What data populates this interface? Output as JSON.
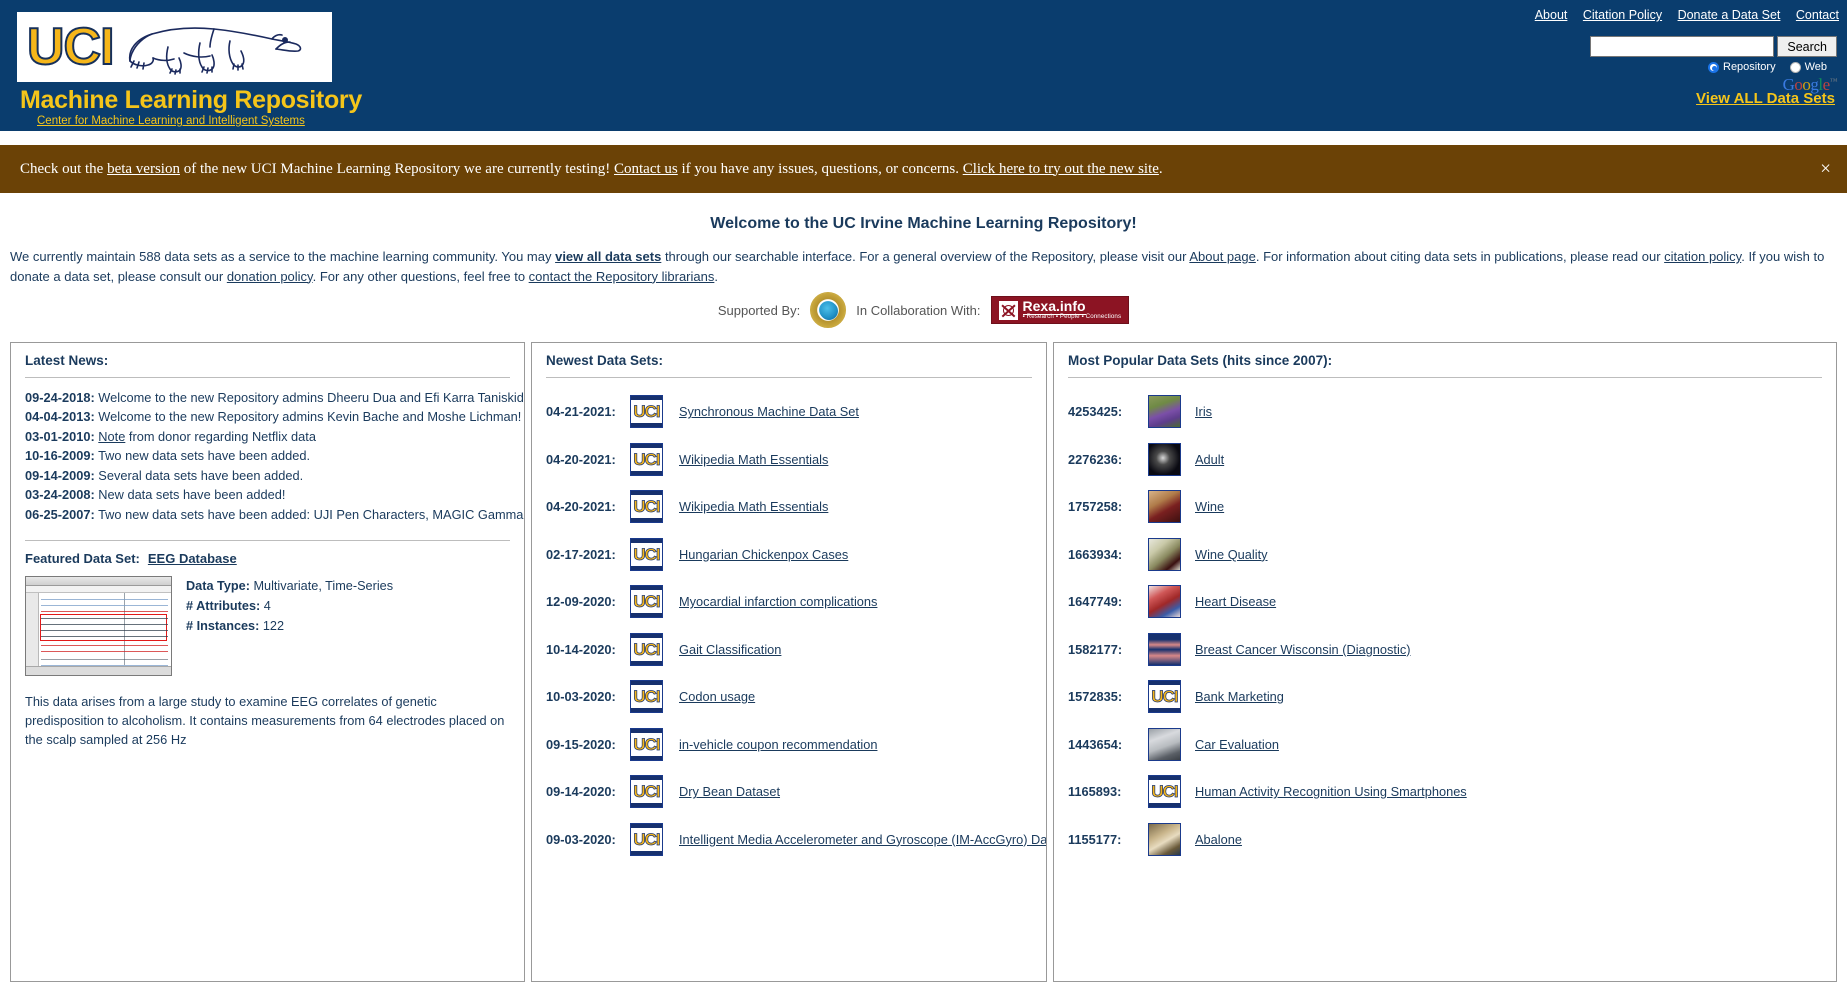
{
  "header": {
    "logo_text": "UCI",
    "repository_title": "Machine Learning Repository",
    "center_link": "Center for Machine Learning and Intelligent Systems",
    "nav": [
      {
        "label": "About"
      },
      {
        "label": "Citation Policy"
      },
      {
        "label": "Donate a Data Set"
      },
      {
        "label": "Contact"
      }
    ],
    "search": {
      "value": "",
      "placeholder": "",
      "button_label": "Search",
      "scope_repository": "Repository",
      "scope_web": "Web",
      "selected_scope": "Repository",
      "provider": "Google",
      "provider_tm": "™"
    },
    "view_all_label": "View ALL Data Sets",
    "colors": {
      "header_blue": "#0a3d6e",
      "gold": "#f5c51a"
    }
  },
  "banner": {
    "text_1": "Check out the ",
    "link_1": "beta version",
    "text_2": " of the new UCI Machine Learning Repository we are currently testing! ",
    "link_2": "Contact us",
    "text_3": " if you have any issues, questions, or concerns. ",
    "link_3": "Click here to try out the new site",
    "text_4": ".",
    "close_icon": "×",
    "color": "#6b4206"
  },
  "welcome": {
    "heading": "Welcome to the UC Irvine Machine Learning Repository!",
    "intro_1": "We currently maintain ",
    "intro_count": "588 data sets",
    "intro_2": " as a service to the machine learning community. You may ",
    "link_view_all": "view all data sets",
    "intro_3": " through our searchable interface. For a general overview of the Repository, please visit our ",
    "link_about": "About page",
    "intro_4": ". For information about citing data sets in publications, please read our ",
    "link_citation": "citation policy",
    "intro_5": ". If you wish to donate a data set, please consult our ",
    "link_donation": "donation policy",
    "intro_6": ". For any other questions, feel free to ",
    "link_librarians": "contact the Repository librarians",
    "intro_7": "."
  },
  "supporters": {
    "supported_by_label": "Supported By:",
    "nsf_name": "National Science Foundation",
    "collaboration_label": "In Collaboration With:",
    "rexa_name": "Rexa.info",
    "rexa_tagline": "▪ Research ▪ People ▪ Connections"
  },
  "news": {
    "heading": "Latest News:",
    "items": [
      {
        "date": "09-24-2018:",
        "text": "Welcome to the new Repository admins Dheeru Dua and Efi Karra Taniskidou!"
      },
      {
        "date": "04-04-2013:",
        "text": "Welcome to the new Repository admins Kevin Bache and Moshe Lichman!"
      },
      {
        "date": "03-01-2010:",
        "link": "Note",
        "text": " from donor regarding Netflix data"
      },
      {
        "date": "10-16-2009:",
        "text": "Two new data sets have been added."
      },
      {
        "date": "09-14-2009:",
        "text": "Several data sets have been added."
      },
      {
        "date": "03-24-2008:",
        "text": "New data sets have been added!"
      },
      {
        "date": "06-25-2007:",
        "text": "Two new data sets have been added: UJI Pen Characters, MAGIC Gamma Telescope"
      }
    ],
    "featured": {
      "label": "Featured Data Set:",
      "link": "EEG Database",
      "data_type_label": "Data Type:",
      "data_type_value": "Multivariate, Time-Series",
      "attributes_label": "# Attributes:",
      "attributes_value": "4",
      "instances_label": "# Instances:",
      "instances_value": "122",
      "description": "This data arises from a large study to examine EEG correlates of genetic predisposition to alcoholism. It contains measurements from 64 electrodes placed on the scalp sampled at 256 Hz"
    }
  },
  "newest": {
    "heading": "Newest Data Sets:",
    "items": [
      {
        "date": "04-21-2021:",
        "name": "Synchronous Machine Data Set",
        "thumb": "uci"
      },
      {
        "date": "04-20-2021:",
        "name": "Wikipedia Math Essentials",
        "thumb": "uci"
      },
      {
        "date": "04-20-2021:",
        "name": "Wikipedia Math Essentials",
        "thumb": "uci"
      },
      {
        "date": "02-17-2021:",
        "name": "Hungarian Chickenpox Cases",
        "thumb": "uci"
      },
      {
        "date": "12-09-2020:",
        "name": "Myocardial infarction complications",
        "thumb": "uci"
      },
      {
        "date": "10-14-2020:",
        "name": "Gait Classification",
        "thumb": "uci"
      },
      {
        "date": "10-03-2020:",
        "name": "Codon usage",
        "thumb": "uci"
      },
      {
        "date": "09-15-2020:",
        "name": "in-vehicle coupon recommendation",
        "thumb": "uci"
      },
      {
        "date": "09-14-2020:",
        "name": "Dry Bean Dataset",
        "thumb": "uci"
      },
      {
        "date": "09-03-2020:",
        "name": "Intelligent Media Accelerometer and Gyroscope (IM-AccGyro) Dataset",
        "thumb": "uci"
      }
    ]
  },
  "popular": {
    "heading": "Most Popular Data Sets (hits since 2007):",
    "items": [
      {
        "hits": "4253425:",
        "name": "Iris",
        "thumb": "iris"
      },
      {
        "hits": "2276236:",
        "name": "Adult",
        "thumb": "adult"
      },
      {
        "hits": "1757258:",
        "name": "Wine",
        "thumb": "wine"
      },
      {
        "hits": "1663934:",
        "name": "Wine Quality",
        "thumb": "wineq"
      },
      {
        "hits": "1647749:",
        "name": "Heart Disease",
        "thumb": "heart"
      },
      {
        "hits": "1582177:",
        "name": "Breast Cancer Wisconsin (Diagnostic)",
        "thumb": "breast"
      },
      {
        "hits": "1572835:",
        "name": "Bank Marketing",
        "thumb": "uci"
      },
      {
        "hits": "1443654:",
        "name": "Car Evaluation",
        "thumb": "car"
      },
      {
        "hits": "1165893:",
        "name": "Human Activity Recognition Using Smartphones",
        "thumb": "uci"
      },
      {
        "hits": "1155177:",
        "name": "Abalone",
        "thumb": "abalone"
      }
    ]
  }
}
